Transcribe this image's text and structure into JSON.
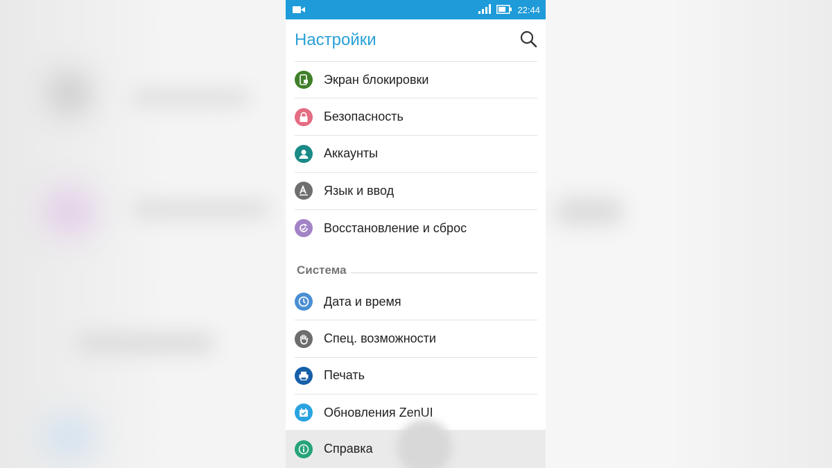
{
  "status_bar": {
    "time": "22:44"
  },
  "app_bar": {
    "title": "Настройки"
  },
  "items_top": [
    {
      "label": "Экран блокировки",
      "icon": "lock-screen-icon",
      "color": "#3f7f2a"
    },
    {
      "label": "Безопасность",
      "icon": "padlock-icon",
      "color": "#e56c82"
    },
    {
      "label": "Аккаунты",
      "icon": "account-icon",
      "color": "#1a8a86"
    },
    {
      "label": "Язык и ввод",
      "icon": "language-icon",
      "color": "#6f6f6f"
    },
    {
      "label": "Восстановление и сброс",
      "icon": "restore-icon",
      "color": "#a383c7"
    }
  ],
  "section": {
    "label": "Система"
  },
  "items_system": [
    {
      "label": "Дата и время",
      "icon": "clock-icon",
      "color": "#4a8fd4"
    },
    {
      "label": "Спец. возможности",
      "icon": "hand-icon",
      "color": "#6d6d6d"
    },
    {
      "label": "Печать",
      "icon": "printer-icon",
      "color": "#1660a8"
    },
    {
      "label": "Обновления ZenUI",
      "icon": "update-icon",
      "color": "#2aa3e0"
    },
    {
      "label": "Справка",
      "icon": "info-icon",
      "color": "#27a37a"
    }
  ]
}
